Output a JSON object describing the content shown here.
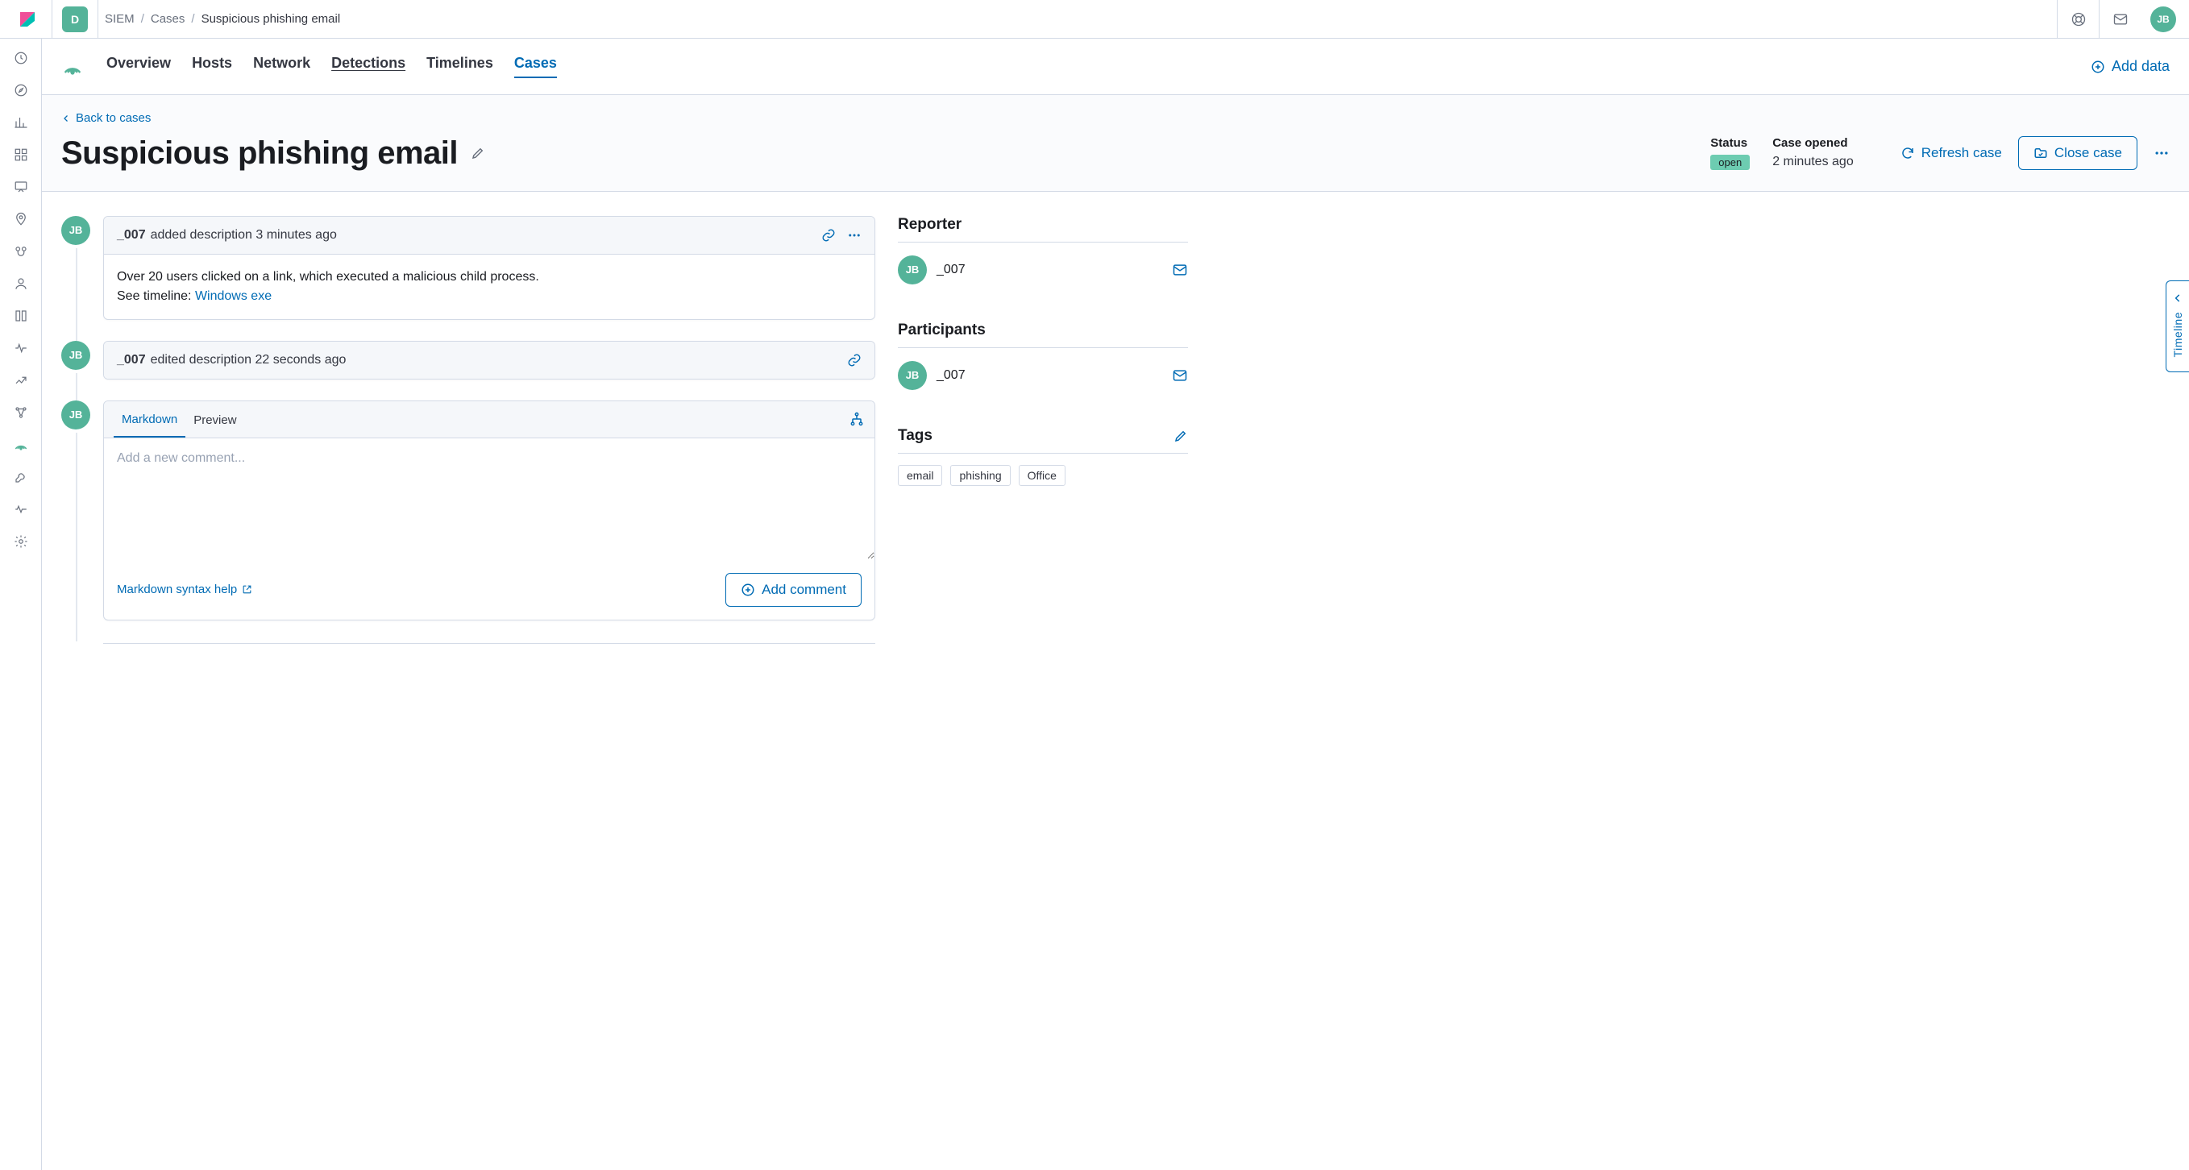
{
  "topbar": {
    "space_initial": "D",
    "avatar_initials": "JB"
  },
  "breadcrumbs": {
    "items": [
      "SIEM",
      "Cases",
      "Suspicious phishing email"
    ],
    "sep": "/"
  },
  "nav": {
    "tabs": [
      "Overview",
      "Hosts",
      "Network",
      "Detections",
      "Timelines",
      "Cases"
    ],
    "active_index": 5,
    "underlined_index": 3,
    "add_data_label": "Add data"
  },
  "header": {
    "back_label": "Back to cases",
    "title": "Suspicious phishing email",
    "status_label": "Status",
    "status_value": "open",
    "opened_label": "Case opened",
    "opened_value": "2 minutes ago",
    "refresh_label": "Refresh case",
    "close_label": "Close case"
  },
  "activity": [
    {
      "avatar": "JB",
      "user": "_007",
      "action": "added description",
      "time": "3 minutes ago",
      "has_body": true,
      "body_line1": "Over 20 users clicked on a link, which executed a malicious child process.",
      "body_line2_prefix": "See timeline: ",
      "body_line2_link": "Windows exe",
      "show_dots": true
    },
    {
      "avatar": "JB",
      "user": "_007",
      "action": "edited description",
      "time": "22 seconds ago",
      "has_body": false,
      "show_dots": false
    }
  ],
  "composer": {
    "avatar": "JB",
    "tabs": [
      "Markdown",
      "Preview"
    ],
    "active_tab_index": 0,
    "placeholder": "Add a new comment...",
    "md_help_label": "Markdown syntax help",
    "add_comment_label": "Add comment"
  },
  "sidebar": {
    "reporter_heading": "Reporter",
    "participants_heading": "Participants",
    "tags_heading": "Tags",
    "reporter": {
      "avatar": "JB",
      "name": "_007"
    },
    "participants": [
      {
        "avatar": "JB",
        "name": "_007"
      }
    ],
    "tags": [
      "email",
      "phishing",
      "Office"
    ]
  },
  "timeline_tab": {
    "label": "Timeline"
  }
}
